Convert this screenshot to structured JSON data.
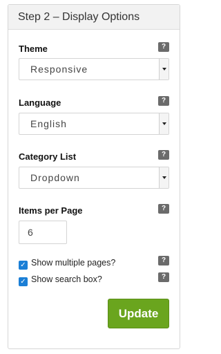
{
  "panel": {
    "title": "Step 2 – Display Options"
  },
  "help_text": "?",
  "theme": {
    "label": "Theme",
    "value": "Responsive"
  },
  "language": {
    "label": "Language",
    "value": "English"
  },
  "category_list": {
    "label": "Category List",
    "value": "Dropdown"
  },
  "items_per_page": {
    "label": "Items per Page",
    "value": "6"
  },
  "checkboxes": {
    "multiple_pages": {
      "label": "Show multiple pages?",
      "checked": true
    },
    "search_box": {
      "label": "Show search box?",
      "checked": true
    }
  },
  "update_button": {
    "label": "Update"
  },
  "colors": {
    "accent": "#6aa51e",
    "checkbox": "#1b7fd6",
    "help_badge": "#6b6b6b"
  }
}
